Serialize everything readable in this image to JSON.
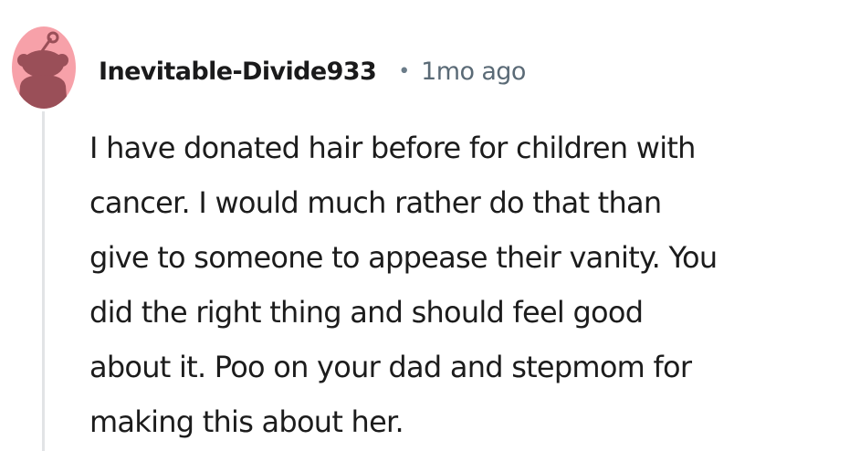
{
  "comment": {
    "author": "Inevitable-Divide933",
    "separator": "•",
    "age": "1mo ago",
    "avatar_icon": "snoo-avatar-icon",
    "avatar_colors": {
      "background": "#f7a1a9",
      "figure": "#9a4f58"
    },
    "thread_line_color": "#e2e4e6",
    "body_lines": [
      "I have donated hair before for children with",
      "cancer. I would much rather do that than",
      "give to someone to appease their vanity. You",
      "did the right thing and should feel good",
      "about it. Poo on your dad and stepmom for",
      "making this about her."
    ]
  }
}
